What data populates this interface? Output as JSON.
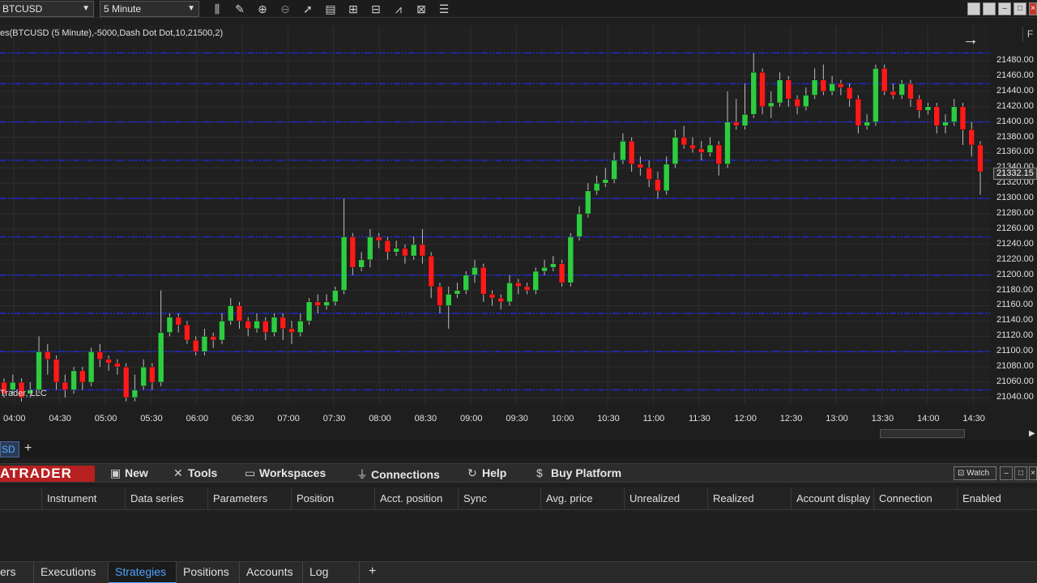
{
  "toolbar": {
    "instrument": "BTCUSD",
    "interval": "5 Minute",
    "tool_icons": [
      "bar-type-icon",
      "pencil-icon",
      "zoom-in-icon",
      "zoom-out-icon",
      "pointer-icon",
      "data-box-icon",
      "chart-trader-icon",
      "properties-icon",
      "indicators-icon",
      "strategies-icon",
      "menu-icon"
    ]
  },
  "chart": {
    "indicator_label": "es(BTCUSD (5 Minute),-5000,Dash Dot Dot,10,21500,2)",
    "copyright": "Trader, LLC",
    "f_label": "F",
    "last_price": "21332.15",
    "price_labels": [
      "21480.00",
      "21460.00",
      "21440.00",
      "21420.00",
      "21400.00",
      "21380.00",
      "21360.00",
      "21340.00",
      "21320.00",
      "21300.00",
      "21280.00",
      "21260.00",
      "21240.00",
      "21220.00",
      "21200.00",
      "21180.00",
      "21160.00",
      "21140.00",
      "21120.00",
      "21100.00",
      "21080.00",
      "21060.00",
      "21040.00"
    ],
    "time_labels": [
      "04:00",
      "04:30",
      "05:00",
      "05:30",
      "06:00",
      "06:30",
      "07:00",
      "07:30",
      "08:00",
      "08:30",
      "09:00",
      "09:30",
      "10:00",
      "10:30",
      "11:00",
      "11:30",
      "12:00",
      "12:30",
      "13:00",
      "13:30",
      "14:00",
      "14:30"
    ],
    "level_lines": [
      21050,
      21100,
      21150,
      21200,
      21250,
      21300,
      21350,
      21400,
      21450,
      21490
    ],
    "colors": {
      "up": "#2ecc40",
      "down": "#ff1a1a",
      "level": "#1f2bd6",
      "grid": "#2e2e2e"
    }
  },
  "chart_data": {
    "type": "candlestick",
    "instrument": "BTCUSD",
    "interval": "5 Minute",
    "ylim": [
      21030,
      21500
    ],
    "candles": [
      [
        21060,
        21045,
        21065,
        21040
      ],
      [
        21050,
        21060,
        21070,
        21045
      ],
      [
        21060,
        21040,
        21065,
        21035
      ],
      [
        21045,
        21050,
        21060,
        21040
      ],
      [
        21050,
        21100,
        21120,
        21045
      ],
      [
        21100,
        21090,
        21110,
        21070
      ],
      [
        21090,
        21060,
        21095,
        21050
      ],
      [
        21060,
        21050,
        21070,
        21040
      ],
      [
        21050,
        21075,
        21080,
        21045
      ],
      [
        21075,
        21060,
        21080,
        21050
      ],
      [
        21060,
        21100,
        21105,
        21055
      ],
      [
        21100,
        21090,
        21110,
        21080
      ],
      [
        21090,
        21085,
        21095,
        21075
      ],
      [
        21085,
        21080,
        21090,
        21070
      ],
      [
        21080,
        21040,
        21085,
        21035
      ],
      [
        21040,
        21050,
        21070,
        21035
      ],
      [
        21055,
        21080,
        21090,
        21050
      ],
      [
        21080,
        21060,
        21085,
        21050
      ],
      [
        21060,
        21125,
        21180,
        21055
      ],
      [
        21125,
        21145,
        21150,
        21120
      ],
      [
        21145,
        21135,
        21150,
        21125
      ],
      [
        21135,
        21115,
        21140,
        21110
      ],
      [
        21115,
        21100,
        21120,
        21095
      ],
      [
        21100,
        21120,
        21130,
        21095
      ],
      [
        21120,
        21115,
        21125,
        21105
      ],
      [
        21115,
        21140,
        21150,
        21110
      ],
      [
        21140,
        21160,
        21170,
        21135
      ],
      [
        21160,
        21140,
        21165,
        21130
      ],
      [
        21140,
        21130,
        21145,
        21120
      ],
      [
        21130,
        21140,
        21150,
        21125
      ],
      [
        21140,
        21125,
        21145,
        21115
      ],
      [
        21125,
        21145,
        21150,
        21120
      ],
      [
        21145,
        21130,
        21150,
        21115
      ],
      [
        21130,
        21125,
        21140,
        21110
      ],
      [
        21125,
        21140,
        21150,
        21120
      ],
      [
        21140,
        21165,
        21170,
        21135
      ],
      [
        21165,
        21160,
        21175,
        21150
      ],
      [
        21160,
        21165,
        21175,
        21155
      ],
      [
        21165,
        21180,
        21185,
        21160
      ],
      [
        21180,
        21250,
        21300,
        21175
      ],
      [
        21250,
        21210,
        21255,
        21200
      ],
      [
        21210,
        21220,
        21230,
        21205
      ],
      [
        21220,
        21250,
        21260,
        21210
      ],
      [
        21250,
        21245,
        21255,
        21235
      ],
      [
        21245,
        21230,
        21250,
        21220
      ],
      [
        21230,
        21235,
        21245,
        21225
      ],
      [
        21235,
        21225,
        21240,
        21215
      ],
      [
        21225,
        21240,
        21250,
        21220
      ],
      [
        21240,
        21225,
        21260,
        21215
      ],
      [
        21225,
        21185,
        21230,
        21170
      ],
      [
        21185,
        21160,
        21190,
        21150
      ],
      [
        21160,
        21175,
        21185,
        21130
      ],
      [
        21175,
        21180,
        21190,
        21170
      ],
      [
        21180,
        21200,
        21205,
        21175
      ],
      [
        21200,
        21210,
        21220,
        21190
      ],
      [
        21210,
        21175,
        21215,
        21165
      ],
      [
        21175,
        21170,
        21180,
        21160
      ],
      [
        21170,
        21165,
        21175,
        21155
      ],
      [
        21165,
        21190,
        21200,
        21160
      ],
      [
        21190,
        21185,
        21195,
        21175
      ],
      [
        21185,
        21180,
        21190,
        21175
      ],
      [
        21180,
        21205,
        21210,
        21175
      ],
      [
        21205,
        21210,
        21220,
        21200
      ],
      [
        21210,
        21215,
        21225,
        21205
      ],
      [
        21215,
        21190,
        21220,
        21185
      ],
      [
        21190,
        21250,
        21255,
        21185
      ],
      [
        21250,
        21280,
        21290,
        21245
      ],
      [
        21280,
        21310,
        21320,
        21275
      ],
      [
        21310,
        21320,
        21330,
        21305
      ],
      [
        21320,
        21325,
        21340,
        21315
      ],
      [
        21325,
        21350,
        21360,
        21320
      ],
      [
        21350,
        21375,
        21385,
        21345
      ],
      [
        21375,
        21345,
        21380,
        21335
      ],
      [
        21345,
        21340,
        21355,
        21330
      ],
      [
        21340,
        21325,
        21350,
        21315
      ],
      [
        21325,
        21310,
        21335,
        21300
      ],
      [
        21310,
        21345,
        21355,
        21305
      ],
      [
        21345,
        21380,
        21390,
        21340
      ],
      [
        21380,
        21370,
        21395,
        21365
      ],
      [
        21370,
        21365,
        21380,
        21360
      ],
      [
        21365,
        21360,
        21375,
        21350
      ],
      [
        21360,
        21370,
        21380,
        21355
      ],
      [
        21370,
        21345,
        21375,
        21330
      ],
      [
        21345,
        21400,
        21440,
        21340
      ],
      [
        21400,
        21395,
        21430,
        21390
      ],
      [
        21395,
        21410,
        21450,
        21390
      ],
      [
        21410,
        21465,
        21490,
        21405
      ],
      [
        21465,
        21420,
        21470,
        21410
      ],
      [
        21420,
        21425,
        21440,
        21405
      ],
      [
        21425,
        21455,
        21465,
        21420
      ],
      [
        21455,
        21430,
        21460,
        21420
      ],
      [
        21430,
        21420,
        21435,
        21410
      ],
      [
        21420,
        21435,
        21445,
        21415
      ],
      [
        21435,
        21455,
        21470,
        21430
      ],
      [
        21455,
        21440,
        21475,
        21435
      ],
      [
        21440,
        21450,
        21460,
        21435
      ],
      [
        21450,
        21445,
        21455,
        21435
      ],
      [
        21445,
        21430,
        21450,
        21420
      ],
      [
        21430,
        21395,
        21435,
        21385
      ],
      [
        21395,
        21400,
        21410,
        21390
      ],
      [
        21400,
        21470,
        21475,
        21395
      ],
      [
        21470,
        21440,
        21475,
        21435
      ],
      [
        21440,
        21435,
        21450,
        21430
      ],
      [
        21435,
        21450,
        21455,
        21430
      ],
      [
        21450,
        21430,
        21455,
        21420
      ],
      [
        21430,
        21415,
        21435,
        21405
      ],
      [
        21415,
        21420,
        21425,
        21410
      ],
      [
        21420,
        21395,
        21425,
        21385
      ],
      [
        21395,
        21400,
        21410,
        21385
      ],
      [
        21400,
        21420,
        21430,
        21395
      ],
      [
        21420,
        21390,
        21425,
        21370
      ],
      [
        21390,
        21370,
        21400,
        21355
      ],
      [
        21370,
        21335,
        21375,
        21305
      ]
    ]
  },
  "tabstrip": {
    "chart_tab": "SD"
  },
  "menubar": {
    "logo": "ATRADER",
    "items": [
      {
        "icon": "new-icon",
        "label": "New"
      },
      {
        "icon": "tools-icon",
        "label": "Tools"
      },
      {
        "icon": "workspaces-icon",
        "label": "Workspaces"
      },
      {
        "icon": "connections-icon",
        "label": "Connections"
      },
      {
        "icon": "help-icon",
        "label": "Help"
      },
      {
        "icon": "dollar-icon",
        "label": "Buy Platform"
      }
    ],
    "watch": "Watch"
  },
  "grid": {
    "columns": [
      "Instrument",
      "Data series",
      "Parameters",
      "Position",
      "Acct. position",
      "Sync",
      "Avg. price",
      "Unrealized",
      "Realized",
      "Account display n",
      "Connection",
      "Enabled"
    ]
  },
  "bottom_tabs": {
    "tabs": [
      "ers",
      "Executions",
      "Strategies",
      "Positions",
      "Accounts",
      "Log"
    ],
    "active": "Strategies"
  }
}
